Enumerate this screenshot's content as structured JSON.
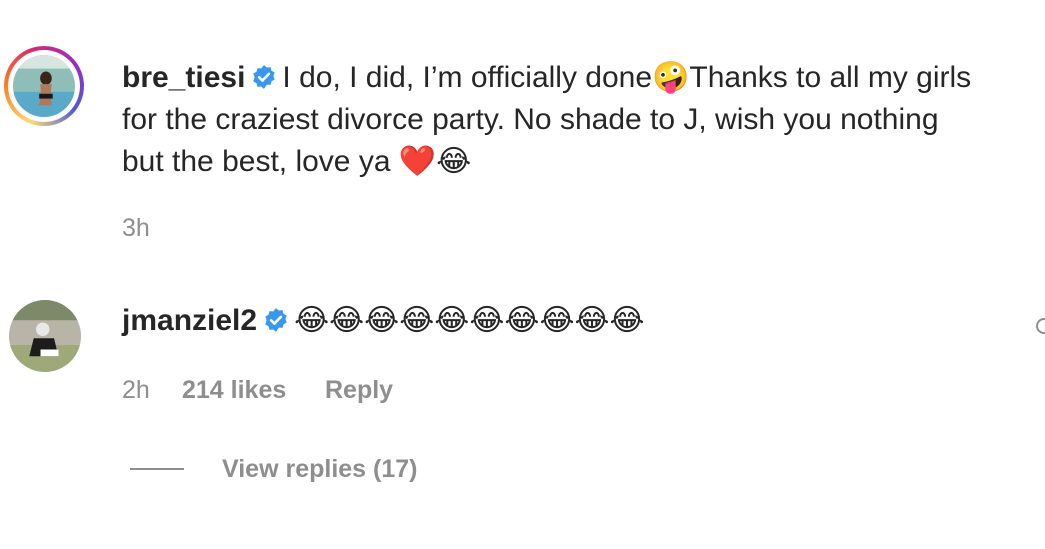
{
  "comment1": {
    "username": "bre_tiesi",
    "text_line1": "I do, I did, I’m officially done🤪Thanks to all my girls",
    "text_line2": "for the craziest divorce party. No shade to J, wish you nothing",
    "text_line3": "but the best, love ya ❤️😂",
    "time": "3h",
    "avatar_icon": "profile-photo-icon",
    "verified_icon": "verified-badge-icon"
  },
  "comment2": {
    "username": "jmanziel2",
    "text": "😂😂😂😂😂😂😂😂😂😂",
    "time": "2h",
    "likes": "214 likes",
    "reply_label": "Reply",
    "view_replies_label": "View replies (17)",
    "avatar_icon": "profile-photo-icon",
    "verified_icon": "verified-badge-icon"
  },
  "colors": {
    "verified_blue": "#3897f0",
    "muted_text": "#8e8e8e",
    "primary_text": "#262626"
  }
}
